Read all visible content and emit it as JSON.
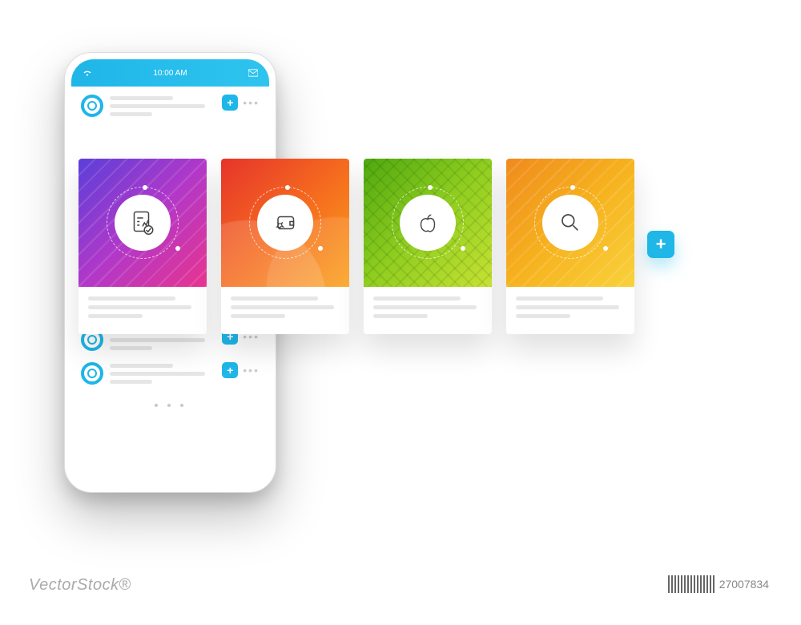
{
  "status_bar": {
    "time": "10:00 AM"
  },
  "cards": [
    {
      "icon": "report-check-icon"
    },
    {
      "icon": "wallet-star-icon"
    },
    {
      "icon": "apple-icon"
    },
    {
      "icon": "search-icon"
    }
  ],
  "watermark": {
    "brand": "VectorStock",
    "id": "27007834"
  },
  "colors": {
    "accent": "#1fb6e8",
    "purple": "#8a3fd0",
    "orange": "#f56a1f",
    "green": "#8fce1f",
    "amber": "#f6b21e"
  }
}
